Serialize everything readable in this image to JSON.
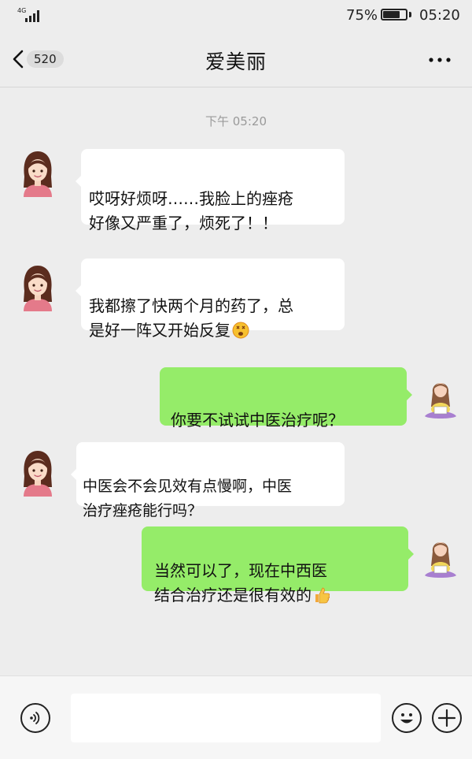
{
  "status_bar": {
    "network": "4G",
    "battery_percent_text": "75%",
    "battery_level": 0.75,
    "time": "05:20"
  },
  "nav": {
    "unread_count": "520",
    "title": "爱美丽",
    "back_icon": "chevron-left-icon",
    "more_icon": "more-dots-icon"
  },
  "chat": {
    "timestamp": "下午 05:20",
    "messages": [
      {
        "side": "in",
        "text": "哎呀好烦呀……我脸上的痤疮\n好像又严重了，烦死了！！"
      },
      {
        "side": "in",
        "text": "我都擦了快两个月的药了，总\n是好一阵又开始反复",
        "emoji": "dizzy-face-emoji"
      },
      {
        "side": "out",
        "text": "你要不试试中医治疗呢？"
      },
      {
        "side": "in",
        "text": "中医会不会见效有点慢啊，中医\n治疗痤疮能行吗？"
      },
      {
        "side": "out",
        "text": "当然可以了，现在中西医\n结合治疗还是很有效的",
        "emoji": "thumbs-up-emoji"
      }
    ]
  },
  "input_bar": {
    "voice_icon": "voice-icon",
    "emoji_icon": "smiley-icon",
    "plus_icon": "plus-icon",
    "placeholder": ""
  },
  "colors": {
    "background": "#ededed",
    "incoming_bubble": "#ffffff",
    "outgoing_bubble": "#95ec69",
    "timestamp": "#9a9a9a"
  }
}
